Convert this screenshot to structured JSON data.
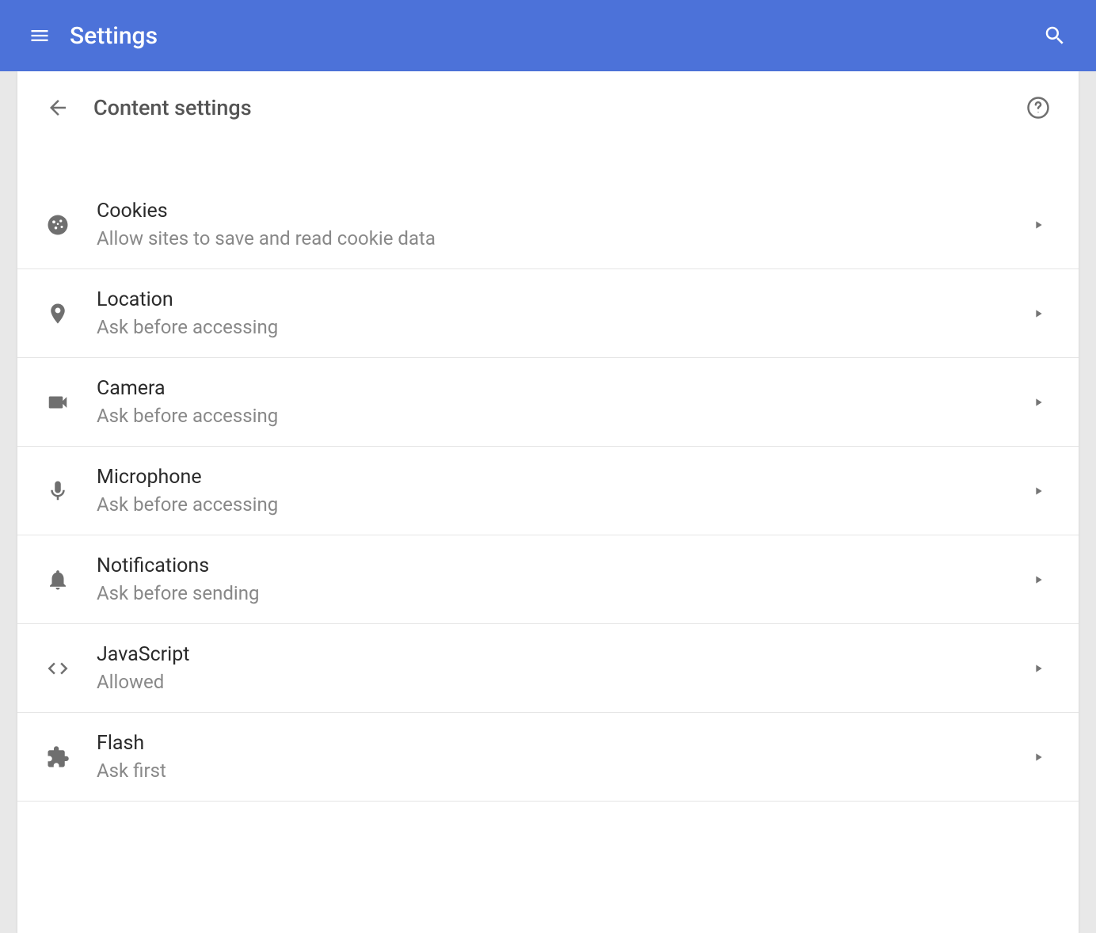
{
  "header": {
    "title": "Settings"
  },
  "page": {
    "title": "Content settings"
  },
  "settings": [
    {
      "icon": "cookie",
      "title": "Cookies",
      "subtitle": "Allow sites to save and read cookie data"
    },
    {
      "icon": "location",
      "title": "Location",
      "subtitle": "Ask before accessing"
    },
    {
      "icon": "camera",
      "title": "Camera",
      "subtitle": "Ask before accessing"
    },
    {
      "icon": "microphone",
      "title": "Microphone",
      "subtitle": "Ask before accessing"
    },
    {
      "icon": "notifications",
      "title": "Notifications",
      "subtitle": "Ask before sending"
    },
    {
      "icon": "javascript",
      "title": "JavaScript",
      "subtitle": "Allowed"
    },
    {
      "icon": "flash",
      "title": "Flash",
      "subtitle": "Ask first"
    }
  ]
}
